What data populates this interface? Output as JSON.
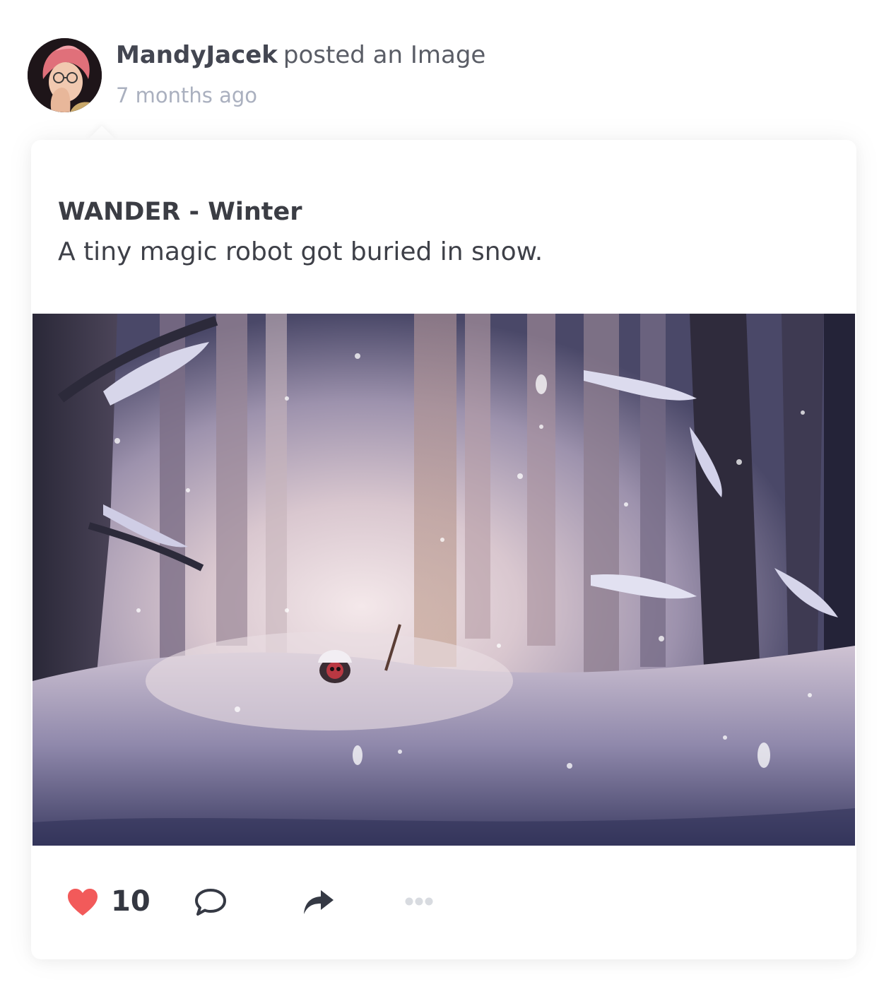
{
  "post": {
    "author": "MandyJacek",
    "action": "posted an Image",
    "timestamp": "7 months ago",
    "title": "WANDER - Winter",
    "description": "A tiny magic robot got buried in snow.",
    "image_alt": "Painting of a snowy forest with a tiny robot buried in snow"
  },
  "actions": {
    "like_count": "10",
    "like_icon": "heart-icon",
    "comment_icon": "comment-icon",
    "share_icon": "share-icon",
    "more_icon": "more-icon"
  },
  "colors": {
    "like": "#f25a5a",
    "icon": "#353944",
    "muted": "#d8dbe0",
    "timestamp": "#aab0bf"
  }
}
